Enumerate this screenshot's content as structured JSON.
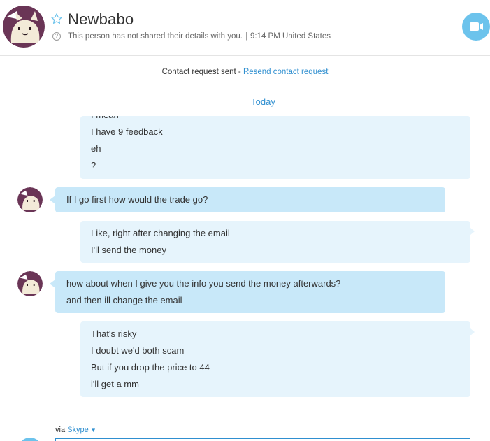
{
  "header": {
    "contact_name": "Newbabo",
    "status_text": "This person has not shared their details with you.",
    "time_location": "9:14 PM United States"
  },
  "request_bar": {
    "text": "Contact request sent - ",
    "resend_label": "Resend contact request"
  },
  "chat": {
    "date_divider": "Today",
    "messages": [
      {
        "from": "me",
        "lines": [
          "I mean",
          "I have 9 feedback",
          "eh",
          "?"
        ]
      },
      {
        "from": "them",
        "lines": [
          "If I go first how would the trade go?"
        ]
      },
      {
        "from": "me",
        "lines": [
          "Like, right after changing the email",
          "I'll send the money"
        ]
      },
      {
        "from": "them",
        "lines": [
          "how about when I give you the info you send the money afterwards?",
          "and then ill change the email"
        ]
      },
      {
        "from": "me",
        "lines": [
          "That's risky",
          "I doubt we'd both scam",
          "But if you drop the price to 44",
          "i'll get a mm"
        ]
      }
    ]
  },
  "footer": {
    "via_label": "via",
    "service_label": "Skype"
  },
  "colors": {
    "accent": "#2f8fd0",
    "video_button": "#6cc3ec",
    "incoming_bubble": "#c8e8f9",
    "outgoing_bubble": "#e6f4fc"
  },
  "icons": {
    "favorite": "star-icon",
    "help": "question-icon",
    "video_call": "video-camera-icon",
    "dropdown": "caret-down-icon"
  }
}
